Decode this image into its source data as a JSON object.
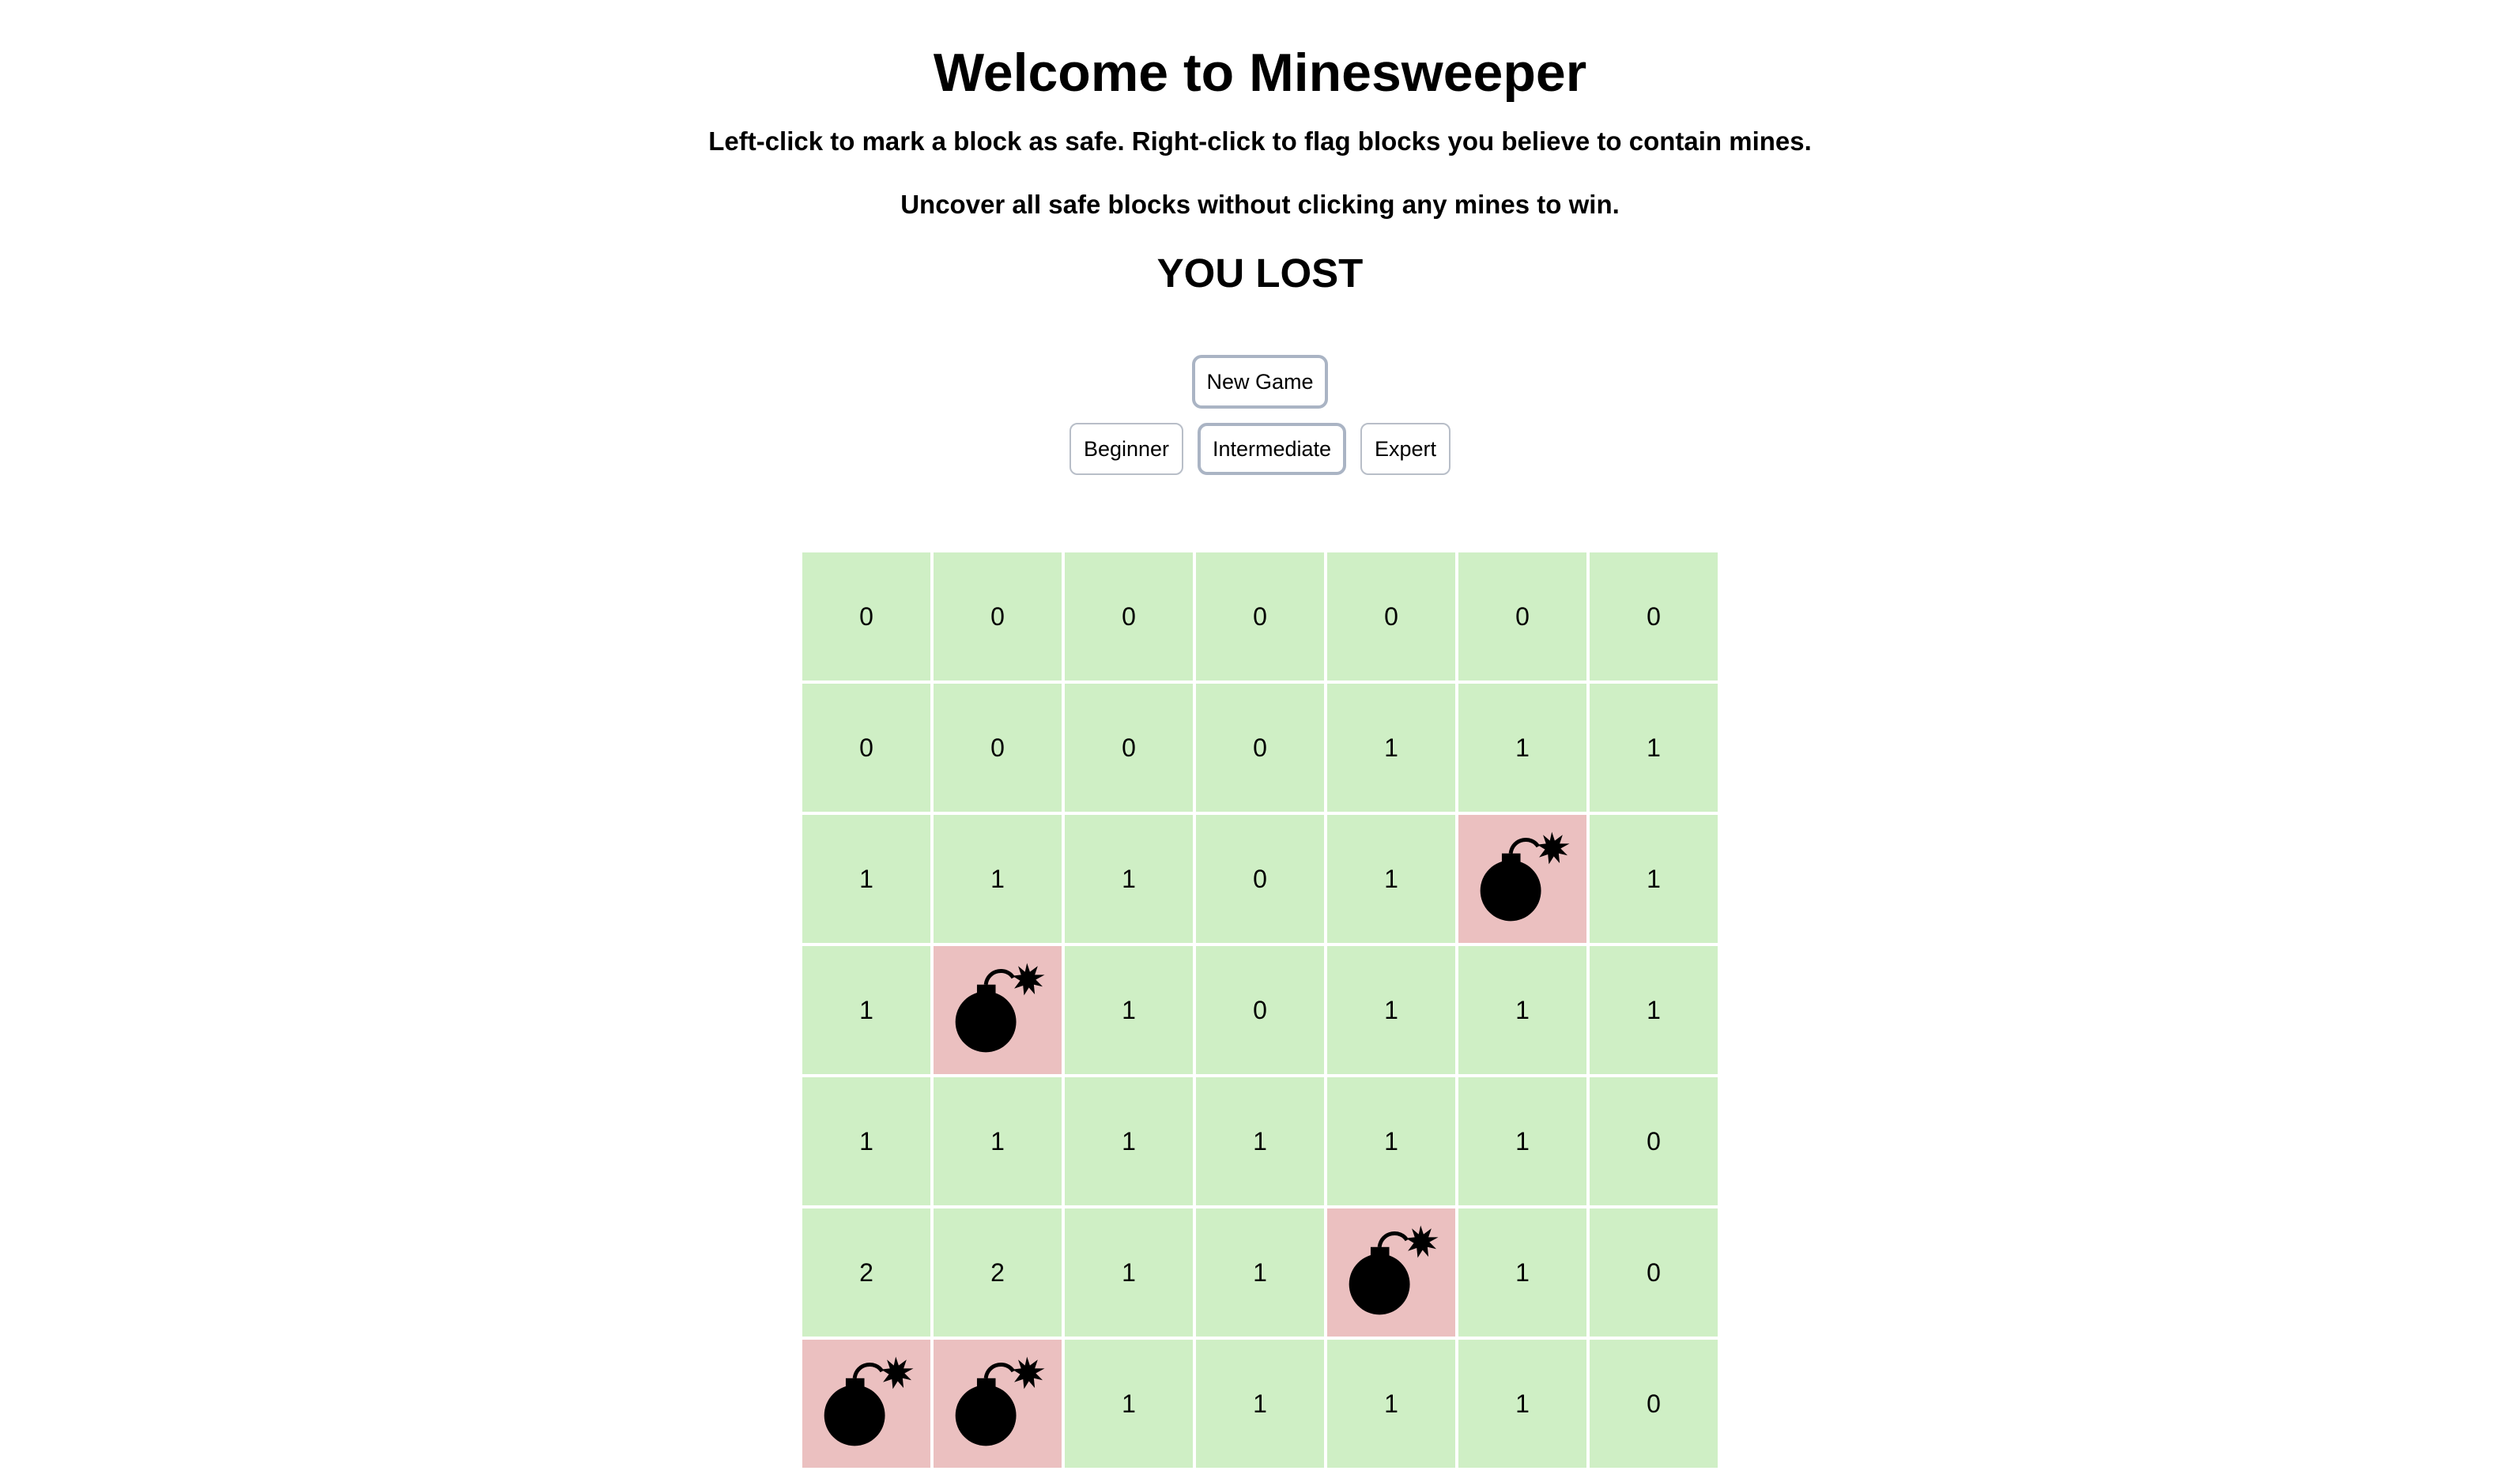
{
  "header": {
    "title": "Welcome to Minesweeper",
    "instruction_1": "Left-click to mark a block as safe. Right-click to flag blocks you believe to contain mines.",
    "instruction_2": "Uncover all safe blocks without clicking any mines to win.",
    "status": "YOU LOST"
  },
  "controls": {
    "new_game_label": "New Game",
    "levels": [
      {
        "label": "Beginner",
        "selected": false
      },
      {
        "label": "Intermediate",
        "selected": true
      },
      {
        "label": "Expert",
        "selected": false
      }
    ]
  },
  "colors": {
    "revealed_safe": "#cfefc5",
    "revealed_mine": "#ebc0c0",
    "selected_border": "#aab4c4"
  },
  "board": {
    "rows": 7,
    "cols": 7,
    "mine_icon": "bomb-icon",
    "cells": [
      [
        "0",
        "0",
        "0",
        "0",
        "0",
        "0",
        "0"
      ],
      [
        "0",
        "0",
        "0",
        "0",
        "1",
        "1",
        "1"
      ],
      [
        "1",
        "1",
        "1",
        "0",
        "1",
        "mine",
        "1"
      ],
      [
        "1",
        "mine",
        "1",
        "0",
        "1",
        "1",
        "1"
      ],
      [
        "1",
        "1",
        "1",
        "1",
        "1",
        "1",
        "0"
      ],
      [
        "2",
        "2",
        "1",
        "1",
        "mine",
        "1",
        "0"
      ],
      [
        "mine",
        "mine",
        "1",
        "1",
        "1",
        "1",
        "0"
      ]
    ]
  }
}
